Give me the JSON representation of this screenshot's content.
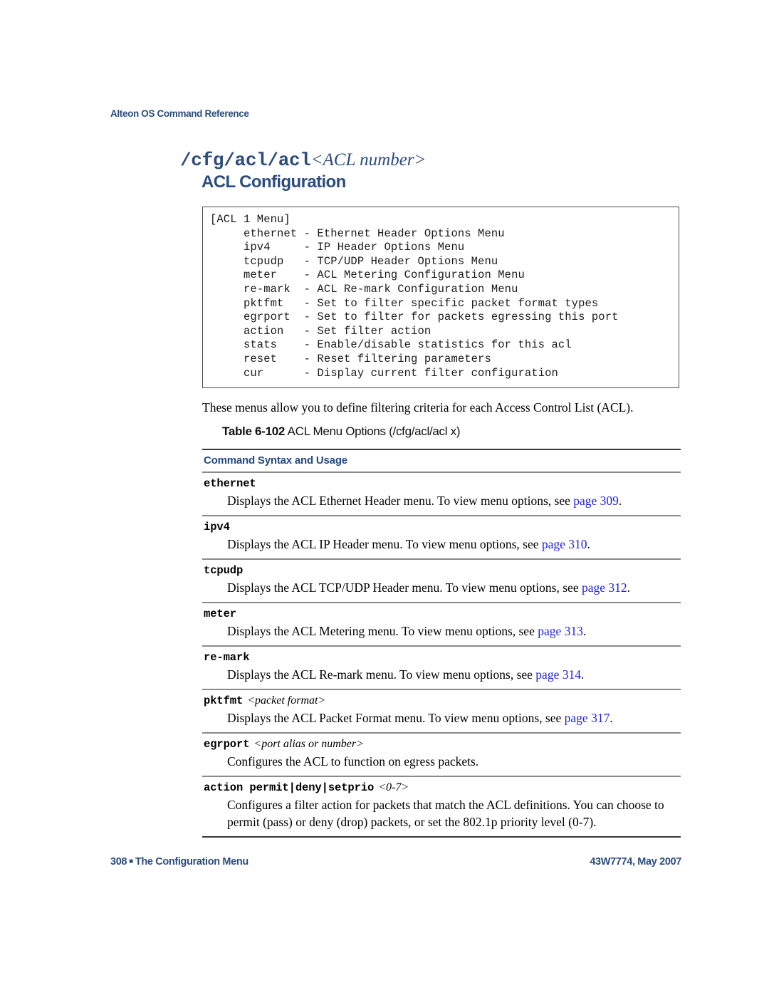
{
  "colors": {
    "heading_blue": "#2C4C7C",
    "column_header_blue": "#21497F",
    "xref_link_blue": "#2222DD",
    "rule_dark": "#3a3a3a",
    "rule_light": "#8a8a8a",
    "page_background": "#ffffff",
    "body_text": "#000000"
  },
  "header": {
    "running_title": "Alteon OS Command Reference"
  },
  "title": {
    "command": "/cfg/acl/acl",
    "parameter": "<ACL number>",
    "subtitle": "ACL Configuration"
  },
  "code_block": {
    "lines": [
      "[ACL 1 Menu]",
      "     ethernet - Ethernet Header Options Menu",
      "     ipv4     - IP Header Options Menu",
      "     tcpudp   - TCP/UDP Header Options Menu",
      "     meter    - ACL Metering Configuration Menu",
      "     re-mark  - ACL Re-mark Configuration Menu",
      "     pktfmt   - Set to filter specific packet format types",
      "     egrport  - Set to filter for packets egressing this port",
      "     action   - Set filter action",
      "     stats    - Enable/disable statistics for this acl",
      "     reset    - Reset filtering parameters",
      "     cur      - Display current filter configuration"
    ]
  },
  "intro_paragraph": "These menus allow you to define filtering criteria for each Access Control List (ACL).",
  "table": {
    "caption_number": "Table 6-102",
    "caption_text": "ACL Menu Options (/cfg/acl/acl x)",
    "column_header": "Command Syntax and Usage",
    "rows": [
      {
        "term": "ethernet",
        "arg": "",
        "desc_before": "Displays the ACL Ethernet Header menu. To view menu options, see ",
        "xref": "page 309",
        "desc_after": "."
      },
      {
        "term": "ipv4",
        "arg": "",
        "desc_before": "Displays the ACL IP Header menu. To view menu options, see ",
        "xref": "page 310",
        "desc_after": "."
      },
      {
        "term": "tcpudp",
        "arg": "",
        "desc_before": "Displays the ACL TCP/UDP Header menu. To view menu options, see ",
        "xref": "page 312",
        "desc_after": "."
      },
      {
        "term": "meter",
        "arg": "",
        "desc_before": "Displays the ACL Metering menu. To view menu options, see ",
        "xref": "page 313",
        "desc_after": "."
      },
      {
        "term": "re-mark",
        "arg": "",
        "desc_before": "Displays the ACL Re-mark menu. To view menu options, see ",
        "xref": "page 314",
        "desc_after": "."
      },
      {
        "term": "pktfmt",
        "arg": "<packet format>",
        "desc_before": "Displays the ACL Packet Format menu. To view menu options, see ",
        "xref": "page 317",
        "desc_after": "."
      },
      {
        "term": "egrport",
        "arg": "<port alias or number>",
        "desc_before": "Configures the ACL to function on egress packets.",
        "xref": "",
        "desc_after": ""
      },
      {
        "term": "action permit|deny|setprio",
        "arg": "<0-7>",
        "desc_before": "Configures a filter action for packets that match the ACL definitions. You can choose to permit (pass) or deny (drop) packets, or set the 802.1p priority level (0-7).",
        "xref": "",
        "desc_after": ""
      }
    ]
  },
  "footer": {
    "page_number": "308",
    "bullet": "■",
    "section_title": "The Configuration Menu",
    "doc_id": "43W7774, May 2007"
  }
}
